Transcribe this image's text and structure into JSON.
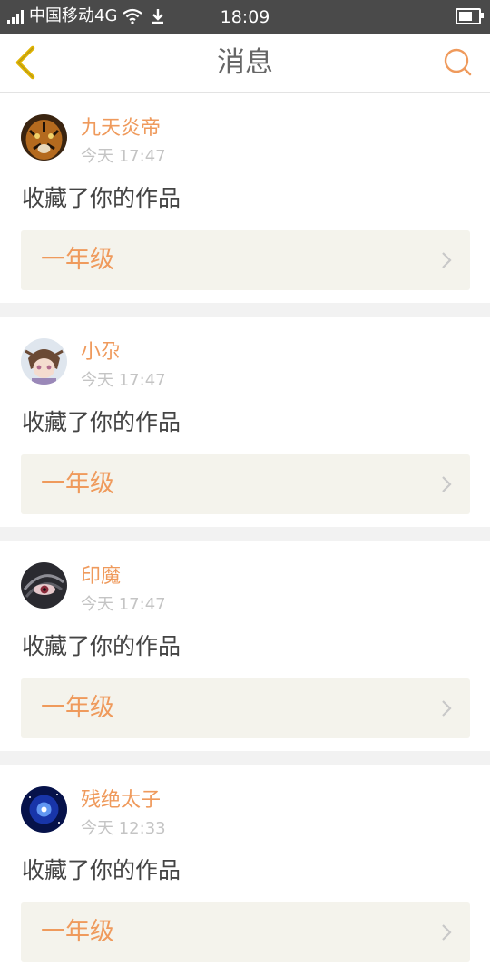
{
  "status_bar": {
    "carrier": "中国移动4G",
    "time": "18:09",
    "battery_level": 0.7
  },
  "header": {
    "title": "消息",
    "back_icon": "chevron-left-icon",
    "search_icon": "search-icon"
  },
  "colors": {
    "accent": "#ef9a5c",
    "back_chevron": "#e0b400",
    "card_box": "#f4f3ec"
  },
  "messages": [
    {
      "user": "九天炎帝",
      "time": "今天 17:47",
      "action": "收藏了你的作品",
      "work": "一年级",
      "avatar": "tiger-avatar"
    },
    {
      "user": "小尕",
      "time": "今天 17:47",
      "action": "收藏了你的作品",
      "work": "一年级",
      "avatar": "anime-girl-avatar"
    },
    {
      "user": "印魔",
      "time": "今天 17:47",
      "action": "收藏了你的作品",
      "work": "一年级",
      "avatar": "eye-avatar"
    },
    {
      "user": "残绝太子",
      "time": "今天 12:33",
      "action": "收藏了你的作品",
      "work": "一年级",
      "avatar": "galaxy-avatar"
    }
  ]
}
